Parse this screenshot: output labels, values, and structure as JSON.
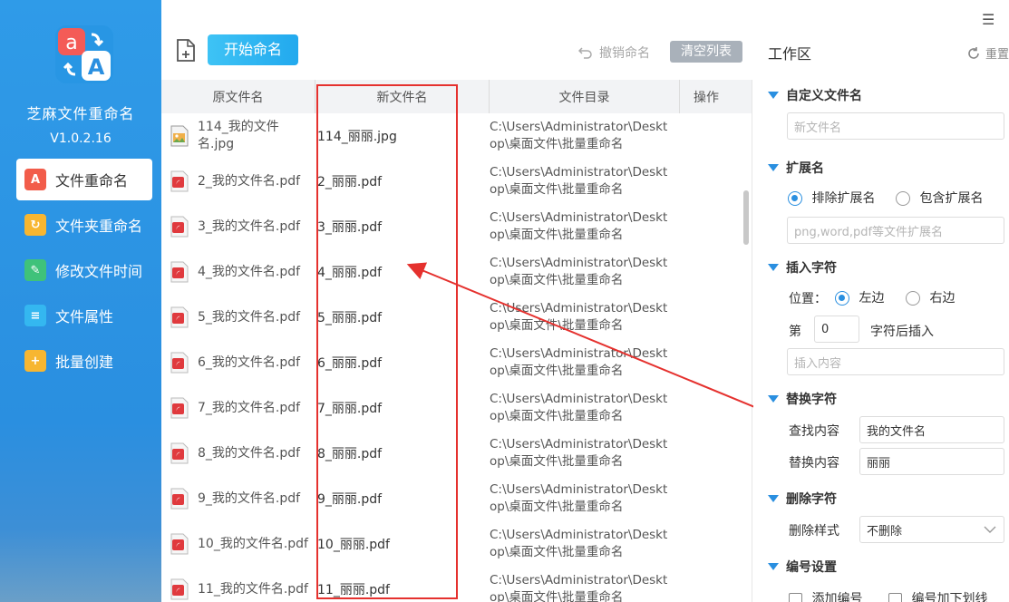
{
  "sidebar": {
    "app_name": "芝麻文件重命名",
    "version": "V1.0.2.16",
    "items": [
      {
        "label": "文件重命名",
        "icon": "file-rename-icon",
        "active": true,
        "color": "#f25c4a"
      },
      {
        "label": "文件夹重命名",
        "icon": "folder-rename-icon",
        "active": false,
        "color": "#f7b631"
      },
      {
        "label": "修改文件时间",
        "icon": "file-time-icon",
        "active": false,
        "color": "#3fc27a"
      },
      {
        "label": "文件属性",
        "icon": "file-attr-icon",
        "active": false,
        "color": "#34b7f0"
      },
      {
        "label": "批量创建",
        "icon": "batch-create-icon",
        "active": false,
        "color": "#f7b631"
      }
    ]
  },
  "toolbar": {
    "start_label": "开始命名",
    "undo_label": "撤销命名",
    "clear_label": "清空列表"
  },
  "table": {
    "headers": [
      "原文件名",
      "新文件名",
      "文件目录",
      "操作"
    ],
    "rows": [
      {
        "orig": "114_我的文件名.jpg",
        "orig_l1": "114_我的文件",
        "orig_l2": "名.jpg",
        "type": "jpg",
        "new": "114_丽丽.jpg",
        "dir1": "C:\\Users\\Administrator\\Deskt",
        "dir2": "op\\桌面文件\\批量重命名"
      },
      {
        "orig": "2_我的文件名.pdf",
        "type": "pdf",
        "new": "2_丽丽.pdf",
        "dir1": "C:\\Users\\Administrator\\Deskt",
        "dir2": "op\\桌面文件\\批量重命名"
      },
      {
        "orig": "3_我的文件名.pdf",
        "type": "pdf",
        "new": "3_丽丽.pdf",
        "dir1": "C:\\Users\\Administrator\\Deskt",
        "dir2": "op\\桌面文件\\批量重命名"
      },
      {
        "orig": "4_我的文件名.pdf",
        "type": "pdf",
        "new": "4_丽丽.pdf",
        "dir1": "C:\\Users\\Administrator\\Deskt",
        "dir2": "op\\桌面文件\\批量重命名"
      },
      {
        "orig": "5_我的文件名.pdf",
        "type": "pdf",
        "new": "5_丽丽.pdf",
        "dir1": "C:\\Users\\Administrator\\Deskt",
        "dir2": "op\\桌面文件\\批量重命名"
      },
      {
        "orig": "6_我的文件名.pdf",
        "type": "pdf",
        "new": "6_丽丽.pdf",
        "dir1": "C:\\Users\\Administrator\\Deskt",
        "dir2": "op\\桌面文件\\批量重命名"
      },
      {
        "orig": "7_我的文件名.pdf",
        "type": "pdf",
        "new": "7_丽丽.pdf",
        "dir1": "C:\\Users\\Administrator\\Deskt",
        "dir2": "op\\桌面文件\\批量重命名"
      },
      {
        "orig": "8_我的文件名.pdf",
        "type": "pdf",
        "new": "8_丽丽.pdf",
        "dir1": "C:\\Users\\Administrator\\Deskt",
        "dir2": "op\\桌面文件\\批量重命名"
      },
      {
        "orig": "9_我的文件名.pdf",
        "type": "pdf",
        "new": "9_丽丽.pdf",
        "dir1": "C:\\Users\\Administrator\\Deskt",
        "dir2": "op\\桌面文件\\批量重命名"
      },
      {
        "orig": "10_我的文件名.pdf",
        "type": "pdf",
        "new": "10_丽丽.pdf",
        "dir1": "C:\\Users\\Administrator\\Deskt",
        "dir2": "op\\桌面文件\\批量重命名"
      },
      {
        "orig": "11_我的文件名.pdf",
        "type": "pdf",
        "new": "11_丽丽.pdf",
        "dir1": "C:\\Users\\Administrator\\Deskt",
        "dir2": "op\\桌面文件\\批量重命名"
      }
    ]
  },
  "panel": {
    "title": "工作区",
    "reset_label": "重置",
    "custom_name": {
      "title": "自定义文件名",
      "placeholder": "新文件名"
    },
    "extension": {
      "title": "扩展名",
      "opt_exclude": "排除扩展名",
      "opt_include": "包含扩展名",
      "selected": "排除扩展名",
      "placeholder": "png,word,pdf等文件扩展名"
    },
    "insert": {
      "title": "插入字符",
      "pos_label": "位置：",
      "opt_left": "左边",
      "opt_right": "右边",
      "selected": "左边",
      "nth_label": "第",
      "nth_value": "0",
      "after_label": "字符后插入",
      "placeholder": "插入内容"
    },
    "replace": {
      "title": "替换字符",
      "find_label": "查找内容",
      "find_value": "我的文件名",
      "replace_label": "替换内容",
      "replace_value": "丽丽"
    },
    "delete": {
      "title": "删除字符",
      "style_label": "删除样式",
      "style_value": "不删除"
    },
    "number": {
      "title": "编号设置",
      "add_label": "添加编号",
      "underline_label": "编号加下划线"
    }
  },
  "colors": {
    "accent": "#2a8fe0",
    "annotation": "#e5312e",
    "pdf": "#e03a3e"
  }
}
